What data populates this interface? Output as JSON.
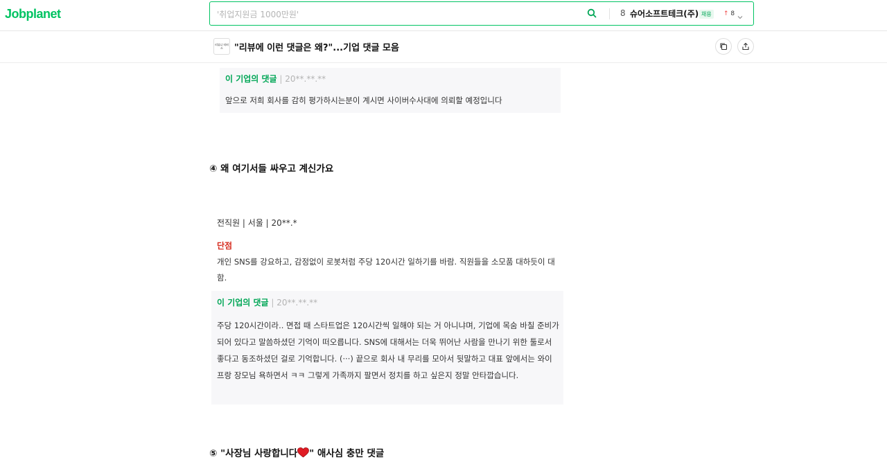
{
  "header": {
    "logo": "Jobplanet",
    "search_placeholder": "'취업지원금 1000만원'",
    "ranking": {
      "rank": "8",
      "company": "슈어소프트테크(주)",
      "badge": "채용",
      "change_arrow": "↑",
      "change_value": "8"
    }
  },
  "subheader": {
    "thumb_text": "리뷰니 티비스",
    "title": "\"리뷰에 이런 댓글은 왜?\"...기업 댓글 모음"
  },
  "content": {
    "comment1": {
      "label": "이 기업의 댓글",
      "sep": " | ",
      "date": "20**.**.**",
      "body": "앞으로 저희 회사를 감히 평가하시는분이 계시면 사이버수사대에 의뢰할 예정입니다"
    },
    "section4": "④ 왜 여기서들 싸우고 계신가요",
    "review": {
      "meta": "전직원 | 서울 | 20**.*",
      "cons_label": "단점",
      "cons_text": "개인 SNS를 강요하고, 감정없이 로봇처럼 주당 120시간 일하기를 바람. 직원들을 소모품 대하듯이 대함."
    },
    "comment2": {
      "label": "이 기업의 댓글",
      "sep": " | ",
      "date": "20**.**.**",
      "body": "주당 120시간이라.. 면접 때 스타트업은 120시간씩 일해야 되는 거 아니냐며, 기업에 목숨 바칠 준비가 되어 있다고 말씀하셨던 기억이 떠오릅니다. SNS에 대해서는 더욱 뛰어난 사람을 만나기 위한 툴로서 좋다고 동조하셨던 걸로 기억합니다. (···) 끝으로 회사 내 무리를 모아서 뒷말하고 대표 앞에서는 와이프랑 장모님 욕하면서 ㅋㅋ 그렇게 가족까지 팔면서 정치를 하고 싶은지 정말 안타깝습니다."
    },
    "section5_prefix": "⑤ \"사장님 사랑합니다",
    "section5_suffix": "\" 애사심 충만 댓글"
  },
  "colors": {
    "brand": "#00c362",
    "cons": "#d62d20"
  },
  "icons": [
    "search-icon",
    "chevron-down-icon",
    "copy-icon",
    "share-icon",
    "heart-icon"
  ]
}
